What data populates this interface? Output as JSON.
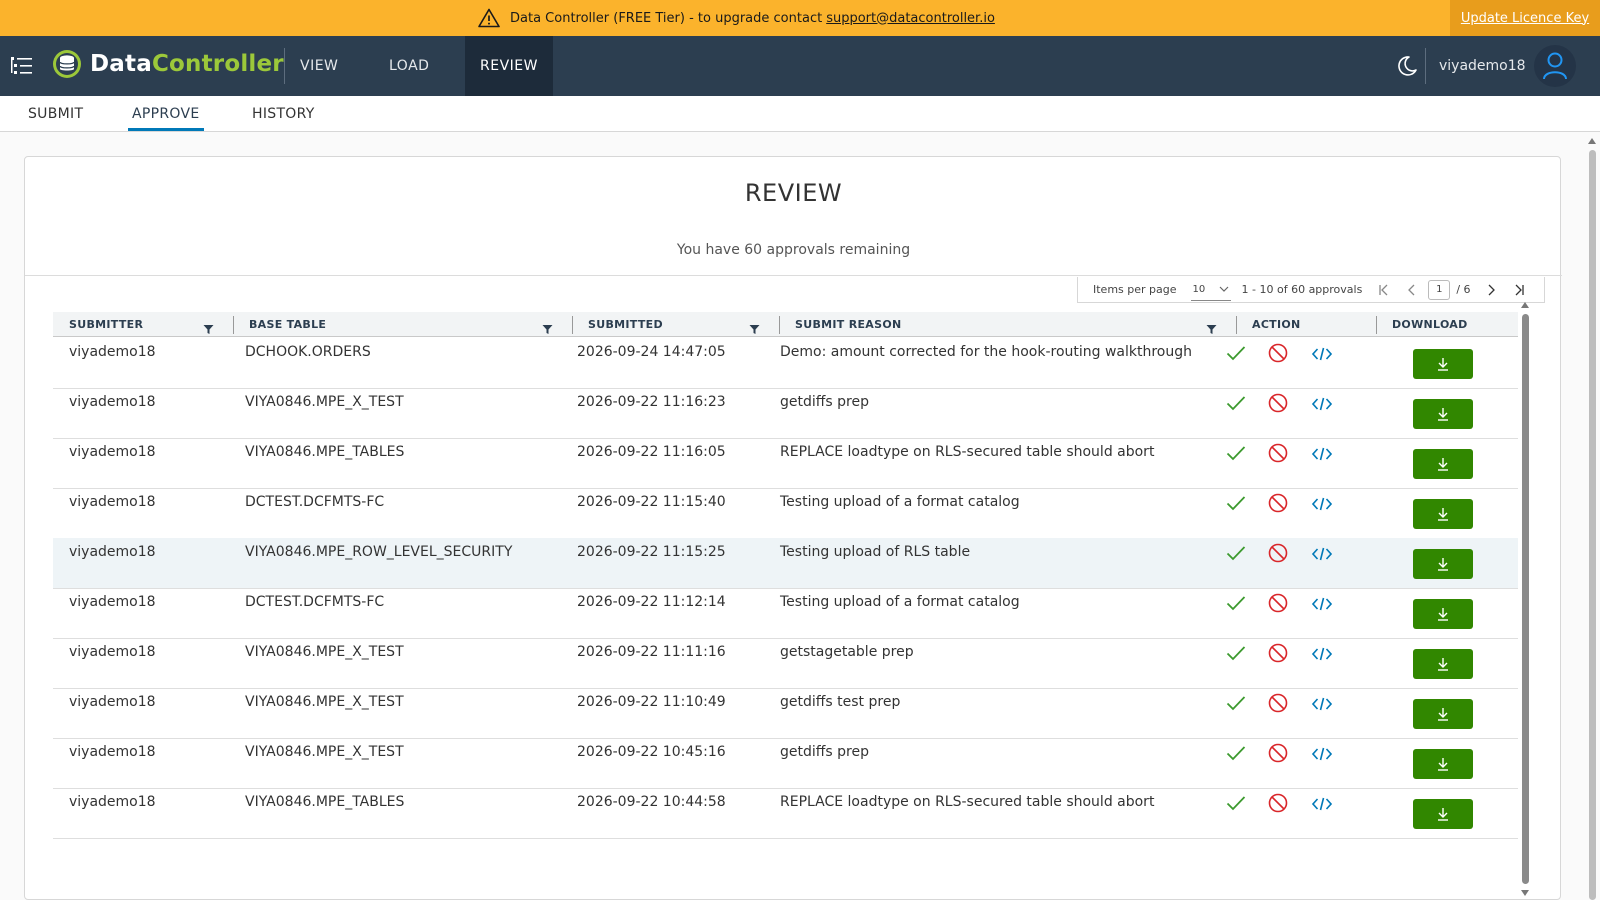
{
  "banner": {
    "message": "Data Controller (FREE Tier) - to upgrade contact",
    "email": "support@datacontroller.io",
    "licence_link": "Update Licence Key"
  },
  "header": {
    "logo_part1": "Data",
    "logo_part2": "Controller",
    "nav": [
      "VIEW",
      "LOAD",
      "REVIEW"
    ],
    "active_nav": "REVIEW",
    "username": "viyademo18"
  },
  "subnav": {
    "tabs": [
      "SUBMIT",
      "APPROVE",
      "HISTORY"
    ],
    "active": "APPROVE"
  },
  "card": {
    "title": "REVIEW",
    "subtitle": "You have 60 approvals remaining"
  },
  "pagination": {
    "items_per_page_label": "Items per page",
    "items_per_page": "10",
    "range": "1 - 10 of 60 approvals",
    "current_page": "1",
    "total_pages": "/ 6"
  },
  "table": {
    "columns": [
      "SUBMITTER",
      "BASE TABLE",
      "SUBMITTED",
      "SUBMIT REASON",
      "ACTION",
      "DOWNLOAD"
    ],
    "rows": [
      {
        "submitter": "viyademo18",
        "base_table": "DCHOOK.ORDERS",
        "submitted": "2026-09-24 14:47:05",
        "reason": "Demo: amount corrected for the hook-routing walkthrough"
      },
      {
        "submitter": "viyademo18",
        "base_table": "VIYA0846.MPE_X_TEST",
        "submitted": "2026-09-22 11:16:23",
        "reason": "getdiffs prep"
      },
      {
        "submitter": "viyademo18",
        "base_table": "VIYA0846.MPE_TABLES",
        "submitted": "2026-09-22 11:16:05",
        "reason": "REPLACE loadtype on RLS-secured table should abort"
      },
      {
        "submitter": "viyademo18",
        "base_table": "DCTEST.DCFMTS-FC",
        "submitted": "2026-09-22 11:15:40",
        "reason": "Testing upload of a format catalog"
      },
      {
        "submitter": "viyademo18",
        "base_table": "VIYA0846.MPE_ROW_LEVEL_SECURITY",
        "submitted": "2026-09-22 11:15:25",
        "reason": "Testing upload of RLS table"
      },
      {
        "submitter": "viyademo18",
        "base_table": "DCTEST.DCFMTS-FC",
        "submitted": "2026-09-22 11:12:14",
        "reason": "Testing upload of a format catalog"
      },
      {
        "submitter": "viyademo18",
        "base_table": "VIYA0846.MPE_X_TEST",
        "submitted": "2026-09-22 11:11:16",
        "reason": "getstagetable prep"
      },
      {
        "submitter": "viyademo18",
        "base_table": "VIYA0846.MPE_X_TEST",
        "submitted": "2026-09-22 11:10:49",
        "reason": "getdiffs test prep"
      },
      {
        "submitter": "viyademo18",
        "base_table": "VIYA0846.MPE_X_TEST",
        "submitted": "2026-09-22 10:45:16",
        "reason": "getdiffs prep"
      },
      {
        "submitter": "viyademo18",
        "base_table": "VIYA0846.MPE_TABLES",
        "submitted": "2026-09-22 10:44:58",
        "reason": "REPLACE loadtype on RLS-secured table should abort"
      }
    ]
  },
  "colors": {
    "banner": "#fbb32c",
    "header": "#2c3e50",
    "accent_green": "#9cc83a",
    "download_button": "#318700",
    "approve_icon": "#3c9a2e",
    "reject_icon": "#d9262a",
    "code_icon": "#0079b8"
  },
  "icons": {
    "banner": "warning-icon",
    "menu": "hamburger-menu-icon",
    "theme": "moon-icon",
    "user": "user-avatar-icon",
    "filter": "filter-icon",
    "approve": "check-icon",
    "reject": "reject-icon",
    "code": "code-icon",
    "download": "download-icon"
  }
}
